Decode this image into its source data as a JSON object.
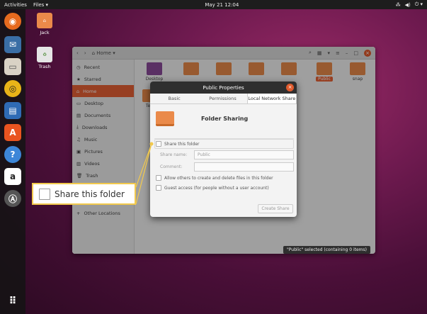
{
  "topbar": {
    "activities": "Activities",
    "files_menu": "Files ▾",
    "clock": "May 21  12:04",
    "network_icon": "network-icon",
    "volume_icon": "volume-icon",
    "power_icon": "power-icon"
  },
  "desktop": {
    "icons": [
      {
        "label": "Jack"
      },
      {
        "label": "Trash"
      }
    ]
  },
  "files_window": {
    "path": "Home",
    "sidebar": [
      {
        "icon": "clock-icon",
        "label": "Recent"
      },
      {
        "icon": "star-icon",
        "label": "Starred"
      },
      {
        "icon": "home-icon",
        "label": "Home"
      },
      {
        "icon": "desktop-icon",
        "label": "Desktop"
      },
      {
        "icon": "document-icon",
        "label": "Documents"
      },
      {
        "icon": "download-icon",
        "label": "Downloads"
      },
      {
        "icon": "music-icon",
        "label": "Music"
      },
      {
        "icon": "picture-icon",
        "label": "Pictures"
      },
      {
        "icon": "video-icon",
        "label": "Videos"
      },
      {
        "icon": "trash-icon",
        "label": "Trash"
      },
      {
        "icon": "plus-icon",
        "label": "Other Locations"
      }
    ],
    "grid": [
      {
        "label": "Desktop"
      },
      {
        "label": "Tem"
      },
      {
        "label": "Public"
      },
      {
        "label": "snap"
      }
    ],
    "status": "\"Public\" selected (containing 0 items)"
  },
  "dialog": {
    "title": "Public Properties",
    "tabs": [
      {
        "label": "Basic"
      },
      {
        "label": "Permissions"
      },
      {
        "label": "Local Network Share"
      }
    ],
    "heading": "Folder Sharing",
    "share_checkbox": "Share this folder",
    "share_name_label": "Share name:",
    "share_name_value": "Public",
    "comment_label": "Comment:",
    "allow_others": "Allow others to create and delete files in this folder",
    "guest_access": "Guest access (for people without a user account)",
    "create_button": "Create Share"
  },
  "callout": {
    "label": "Share this folder"
  }
}
